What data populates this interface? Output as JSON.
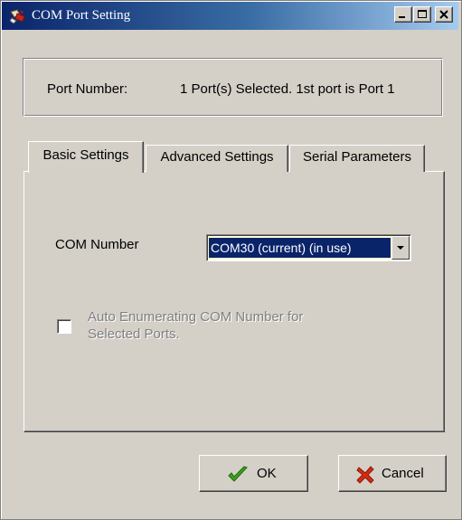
{
  "window": {
    "title": "COM Port Setting",
    "icons": {
      "app": "com-port-app-icon",
      "minimize": "minimize-icon",
      "maximize": "maximize-icon",
      "close": "close-icon"
    }
  },
  "port_info": {
    "label": "Port Number:",
    "value": "1 Port(s) Selected. 1st port is Port 1"
  },
  "tabs": [
    {
      "label": "Basic Settings",
      "active": true
    },
    {
      "label": "Advanced Settings",
      "active": false
    },
    {
      "label": "Serial Parameters",
      "active": false
    }
  ],
  "basic": {
    "com_label": "COM Number",
    "com_selected": "COM30 (current) (in use)",
    "auto_enum_label": "Auto Enumerating COM Number for Selected Ports.",
    "auto_enum_checked": false,
    "auto_enum_enabled": false
  },
  "buttons": {
    "ok": {
      "label": "OK",
      "icon": "check-icon",
      "icon_color": "#3ca11e"
    },
    "cancel": {
      "label": "Cancel",
      "icon": "x-icon",
      "icon_color": "#d52b0f"
    }
  },
  "colors": {
    "face": "#d4d0c8",
    "title_start": "#0a246a",
    "title_end": "#a6caf0",
    "selection": "#0a246a"
  }
}
